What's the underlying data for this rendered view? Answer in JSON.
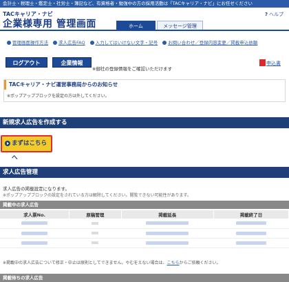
{
  "topbar": {
    "text": "会計士・税理士・鑑定士・社労士・簿記など、有資格者・勉強中の方の採用活動は「TACキャリア・ナビ」にお任せください"
  },
  "header": {
    "brand_small": "TACキャリア・ナビ",
    "brand_big": "企業様専用 管理画面",
    "help_mark": "?",
    "help_label": "ヘルプ",
    "tabs": [
      {
        "label": "ホーム"
      },
      {
        "label": "メッセージ管理"
      }
    ]
  },
  "links": [
    {
      "label": "管理画面操作方法"
    },
    {
      "label": "求人広告FAQ"
    },
    {
      "label": "入力してはいけない文字・記号"
    },
    {
      "label": "お問い合わせ／登録内容変更／掲載申込依頼"
    }
  ],
  "buttons": {
    "logout": "ログアウト",
    "company": "企業情報"
  },
  "reg_note": "※御社の登録情報をご確認いただけます",
  "apply_label": "申込書",
  "notice": {
    "title": "TACキャリア・ナビ運営事務局からのお知らせ",
    "body": "※ポップアップブロックを設定の方は外してください。"
  },
  "sections": {
    "new_ad": {
      "title": "新規求人広告を作成する",
      "button": "まずはこちらへ"
    },
    "mgmt": {
      "title": "求人広告管理",
      "desc": "求人広告の掲載設定になります。",
      "note": "※ポップアップブロックの設定をされている方は解除してください。閲覧できない可能性があります。"
    }
  },
  "table": {
    "title": "掲載中の求人広告",
    "headers": [
      "求人票No.",
      "原稿管理",
      "掲載延長",
      "掲載終了日"
    ],
    "row_count": 3
  },
  "table_note": {
    "text": "※掲載中の求人広告について修正・中止は原則としてできません。やむをえない場合は、",
    "link": "こちら",
    "tail": "からご依頼ください。"
  },
  "pending": {
    "title": "掲載待ちの求人広告"
  },
  "colors": {
    "primary": "#1d4a96",
    "topbar": "#2a5ca8",
    "accent_button": "#f2ca2a",
    "accent_border": "#e12d2d"
  }
}
